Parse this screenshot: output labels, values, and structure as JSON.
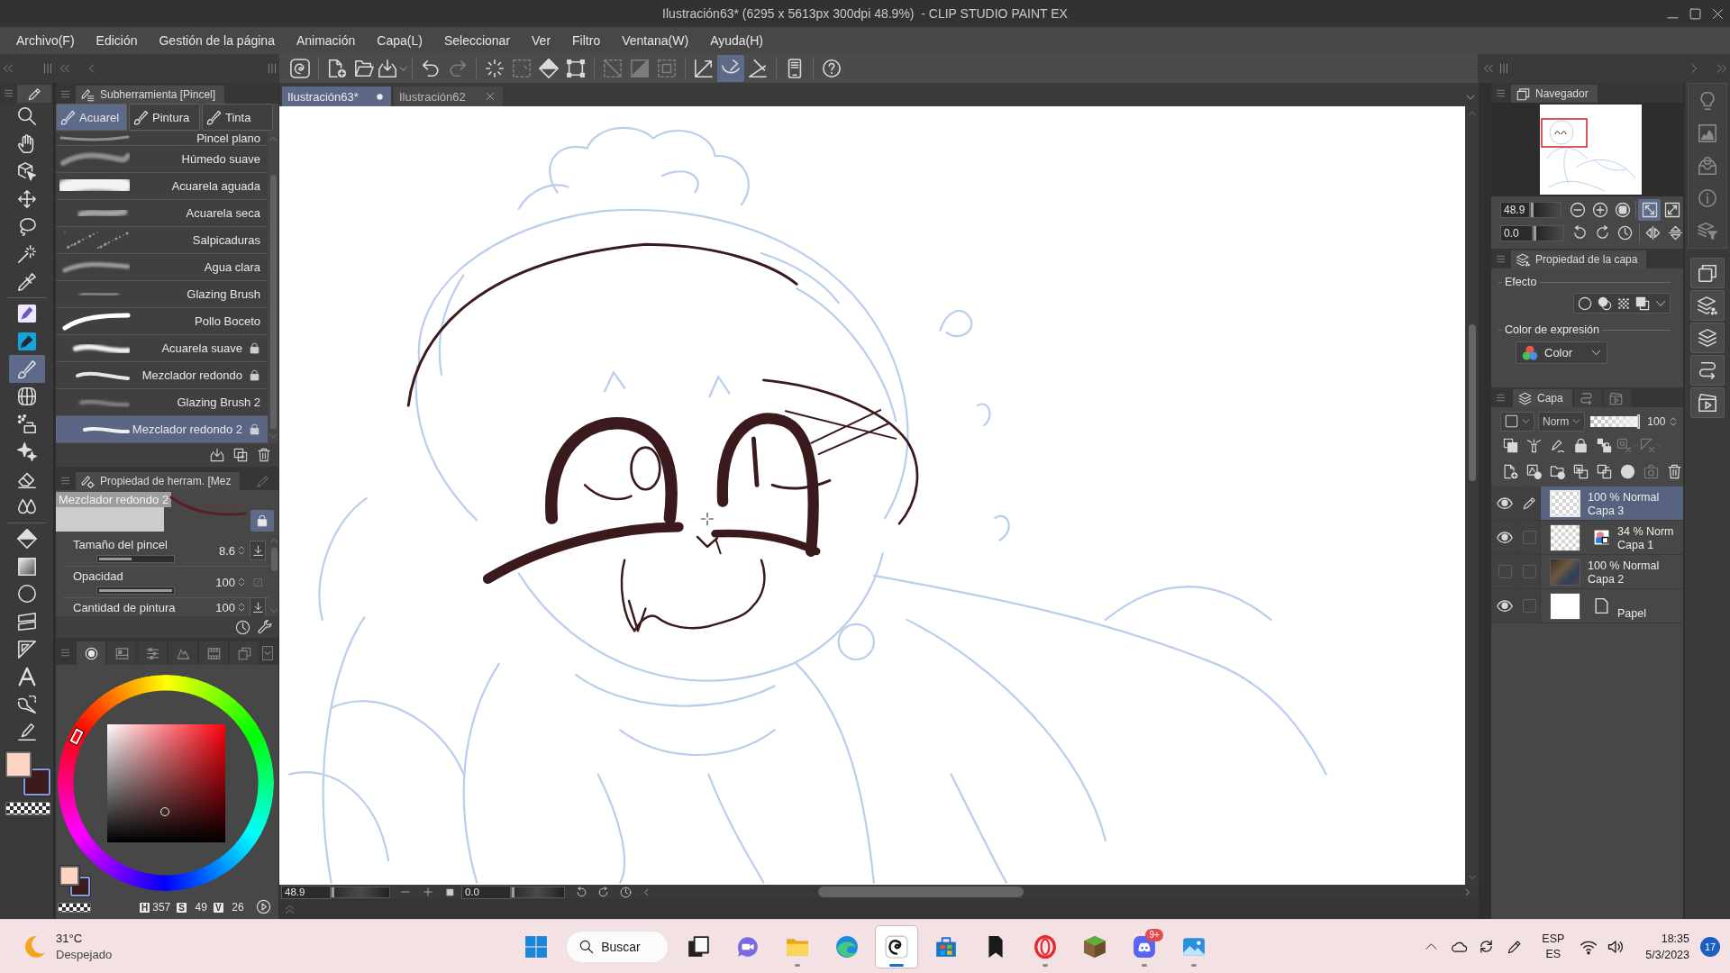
{
  "window": {
    "title": "Ilustración63* (6295 x 5613px 300dpi 48.9%)  - CLIP STUDIO PAINT EX"
  },
  "menu": [
    "Archivo(F)",
    "Edición",
    "Gestión de la página",
    "Animación",
    "Capa(L)",
    "Seleccionar",
    "Ver",
    "Filtro",
    "Ventana(W)",
    "Ayuda(H)"
  ],
  "command_groups": [
    [
      {
        "kind": "logo",
        "selected": false,
        "disabled": false
      }
    ],
    [
      {
        "kind": "newpage",
        "selected": false,
        "disabled": false
      },
      {
        "kind": "folder",
        "selected": false,
        "disabled": false
      },
      {
        "kind": "export",
        "selected": false,
        "disabled": false
      }
    ],
    [
      {
        "kind": "undo",
        "selected": false,
        "disabled": false
      },
      {
        "kind": "redo",
        "selected": false,
        "disabled": true
      }
    ],
    [
      {
        "kind": "burst",
        "selected": false,
        "disabled": false
      },
      {
        "kind": "dashsquare",
        "selected": false,
        "disabled": true
      },
      {
        "kind": "bucket",
        "selected": false,
        "disabled": false
      },
      {
        "kind": "transform",
        "selected": false,
        "disabled": false
      }
    ],
    [
      {
        "kind": "diagonal",
        "selected": false,
        "disabled": true
      },
      {
        "kind": "halffill",
        "selected": false,
        "disabled": true
      },
      {
        "kind": "dashframe",
        "selected": false,
        "disabled": true
      }
    ],
    [
      {
        "kind": "cornerline",
        "selected": false,
        "disabled": false
      },
      {
        "kind": "curve",
        "selected": true,
        "disabled": false
      },
      {
        "kind": "angle",
        "selected": false,
        "disabled": false
      }
    ],
    [
      {
        "kind": "phone",
        "selected": false,
        "disabled": false
      }
    ],
    [
      {
        "kind": "help",
        "selected": false,
        "disabled": false
      }
    ]
  ],
  "tools": [
    [
      {
        "kind": "magnifier",
        "selected": false
      },
      {
        "kind": "hand",
        "selected": false
      },
      {
        "kind": "cube",
        "selected": false
      },
      {
        "kind": "arrows",
        "selected": false
      },
      {
        "kind": "lasso",
        "selected": false
      },
      {
        "kind": "wand",
        "selected": false
      },
      {
        "kind": "dropper",
        "selected": false
      }
    ],
    [
      {
        "kind": "pentile",
        "selected": false
      },
      {
        "kind": "markertile",
        "selected": false
      },
      {
        "kind": "brush",
        "selected": true
      },
      {
        "kind": "globe",
        "selected": false
      },
      {
        "kind": "airbrush",
        "selected": false
      },
      {
        "kind": "sparkle",
        "selected": false
      },
      {
        "kind": "eraser",
        "selected": false
      },
      {
        "kind": "drops",
        "selected": false
      }
    ],
    [
      {
        "kind": "bucket",
        "selected": false
      },
      {
        "kind": "gradient",
        "selected": false
      },
      {
        "kind": "circle",
        "selected": false
      },
      {
        "kind": "frame",
        "selected": false
      },
      {
        "kind": "triangle",
        "selected": false
      },
      {
        "kind": "letter",
        "selected": false
      },
      {
        "kind": "balloon",
        "selected": false
      },
      {
        "kind": "liner",
        "selected": false
      }
    ]
  ],
  "colors": [
    {
      "kind": "main",
      "color": "#fdd3c1",
      "selected": false
    },
    {
      "kind": "sub",
      "color": "#3c1b1e",
      "selected": true
    }
  ],
  "sub_tool": {
    "title": "Subherramienta [Pincel]",
    "groups": [
      {
        "label": "Acuarel",
        "selected": true
      },
      {
        "label": "Pintura",
        "selected": false
      },
      {
        "label": "Tinta",
        "selected": false
      }
    ],
    "items": [
      {
        "label": "Pincel plano",
        "selected": false,
        "locked": false
      },
      {
        "label": "Húmedo suave",
        "selected": false,
        "locked": false
      },
      {
        "label": "Acuarela aguada",
        "selected": false,
        "locked": false
      },
      {
        "label": "Acuarela seca",
        "selected": false,
        "locked": false
      },
      {
        "label": "Salpicaduras",
        "selected": false,
        "locked": false
      },
      {
        "label": "Agua clara",
        "selected": false,
        "locked": false
      },
      {
        "label": "Glazing Brush",
        "selected": false,
        "locked": false
      },
      {
        "label": "Pollo Boceto",
        "selected": false,
        "locked": false
      },
      {
        "label": "Acuarela suave",
        "selected": false,
        "locked": true
      },
      {
        "label": "Mezclador redondo",
        "selected": false,
        "locked": true
      },
      {
        "label": "Glazing Brush 2",
        "selected": false,
        "locked": false
      },
      {
        "label": "Mezclador redondo 2",
        "selected": true,
        "locked": true
      }
    ]
  },
  "tool_property": {
    "title": "Propiedad de herram. [Mez",
    "preset": "Mezclador redondo 2",
    "locked": true,
    "properties": [
      {
        "label": "Tamaño del pincel",
        "value": "8.6",
        "level": 0.45,
        "pressure": true
      },
      {
        "label": "Opacidad",
        "value": "100",
        "level": 1,
        "pressure": false
      },
      {
        "label": "Cantidad de pintura",
        "value": "100",
        "pressure": true
      }
    ]
  },
  "color_panel": {
    "tabs": [
      {
        "kind": "ringdot",
        "selected": true
      },
      {
        "kind": "swatchgrid",
        "selected": false
      },
      {
        "kind": "sliders",
        "selected": false
      },
      {
        "kind": "mountain",
        "selected": false
      },
      {
        "kind": "film",
        "selected": false
      },
      {
        "kind": "stackpanel",
        "selected": false
      }
    ],
    "hsv": [
      {
        "label": "H",
        "value": "357"
      },
      {
        "label": "S",
        "value": "49"
      },
      {
        "label": "V",
        "value": "26"
      }
    ]
  },
  "canvas": {
    "tabs": [
      {
        "label": "Ilustración63*",
        "selected": true,
        "modified": true
      },
      {
        "label": "Ilustración62",
        "selected": false,
        "modified": false
      }
    ],
    "zoom": "48.9",
    "zoom_slider": {
      "level": 0
    },
    "rotation": "0.0",
    "rotation_slider": {
      "level": 0
    }
  },
  "navigator": {
    "title": "Navegador",
    "zoom": "48.9",
    "zoom_slider": {
      "level": 0
    },
    "rotation": "0.0",
    "rotation_slider": {
      "level": 0
    },
    "buttons": [
      {
        "kind": "zoomout",
        "selected": false
      },
      {
        "kind": "zoomin",
        "selected": false
      },
      {
        "kind": "actual",
        "selected": false
      },
      {
        "kind": "fit",
        "selected": true
      },
      {
        "kind": "fill",
        "selected": false
      }
    ]
  },
  "layer_property": {
    "title": "Propiedad de la capa",
    "effect_label": "Efecto",
    "expression_label": "Color de expresión",
    "expression": "Color"
  },
  "layers_panel": {
    "tabs": [
      {
        "kind": "layers",
        "label": "Capa",
        "selected": true
      },
      {
        "kind": "loop",
        "selected": false
      },
      {
        "kind": "clapper",
        "selected": false
      }
    ],
    "blend_mode": "Norm",
    "opacity_slider": {
      "level": 1
    },
    "opacity": "100",
    "tool_rows": [
      [
        {
          "kind": "clip",
          "disabled": false
        },
        {
          "kind": "lighthouse",
          "disabled": false
        },
        {
          "kind": "draft",
          "disabled": false
        },
        {
          "kind": "lock",
          "disabled": false
        },
        {
          "kind": "lockalpha",
          "disabled": false
        },
        {
          "kind": "maskx",
          "disabled": true
        },
        {
          "kind": "rulerx",
          "disabled": true
        }
      ],
      [
        {
          "kind": "newpage",
          "disabled": false
        },
        {
          "kind": "newvector",
          "disabled": false
        },
        {
          "kind": "newfolder",
          "disabled": false
        },
        {
          "kind": "transfer",
          "disabled": false
        },
        {
          "kind": "combine",
          "disabled": false
        },
        {
          "kind": "maskdot",
          "disabled": false
        },
        {
          "kind": "camera",
          "disabled": true
        },
        {
          "kind": "trash",
          "disabled": false
        }
      ]
    ],
    "layers": [
      {
        "info": "100 % Normal",
        "name": "Capa 3",
        "kind": "raster",
        "visible": true,
        "editing": true,
        "selected": true
      },
      {
        "info": "34 % Norm",
        "name": "Capa 1",
        "kind": "colored",
        "visible": true,
        "editing": false,
        "selected": false
      },
      {
        "info": "100 % Normal",
        "name": "Capa 2",
        "kind": "photo",
        "visible": false,
        "editing": false,
        "selected": false
      },
      {
        "name": "Papel",
        "kind": "paper",
        "visible": true,
        "editing": false,
        "selected": false
      }
    ]
  },
  "side_groups": [
    {
      "kind": "plain",
      "items": [
        {
          "kind": "bulb"
        },
        {
          "kind": "histogram"
        },
        {
          "kind": "tray"
        },
        {
          "kind": "info"
        },
        {
          "kind": "layersfilter"
        }
      ]
    },
    {
      "kind": "tiled",
      "items": [
        {
          "kind": "stack"
        },
        {
          "kind": "layersdots"
        },
        {
          "kind": "layers"
        },
        {
          "kind": "loop"
        },
        {
          "kind": "clapper"
        }
      ]
    }
  ],
  "taskbar": {
    "weather": {
      "temperature": "31°C",
      "condition": "Despejado"
    },
    "apps": [
      {
        "kind": "start",
        "running": false,
        "active": false
      },
      {
        "kind": "search",
        "label": "Buscar"
      },
      {
        "kind": "taskview",
        "running": false,
        "active": false
      },
      {
        "kind": "teams",
        "running": false,
        "active": false
      },
      {
        "kind": "explorer",
        "running": true,
        "active": false
      },
      {
        "kind": "edge",
        "running": false,
        "active": false
      },
      {
        "kind": "csp",
        "running": true,
        "active": true
      },
      {
        "kind": "store",
        "running": false,
        "active": false
      },
      {
        "kind": "bookmark",
        "running": false,
        "active": false
      },
      {
        "kind": "opera",
        "running": true,
        "active": false
      },
      {
        "kind": "minecraft",
        "running": false,
        "active": false
      },
      {
        "kind": "discord",
        "running": true,
        "active": false,
        "badge": "9+"
      },
      {
        "kind": "photos",
        "running": true,
        "active": false
      }
    ],
    "tray": {
      "language": "ESP",
      "layout": "ES",
      "time": "18:35",
      "date": "5/3/2023",
      "notifications": "17"
    }
  }
}
